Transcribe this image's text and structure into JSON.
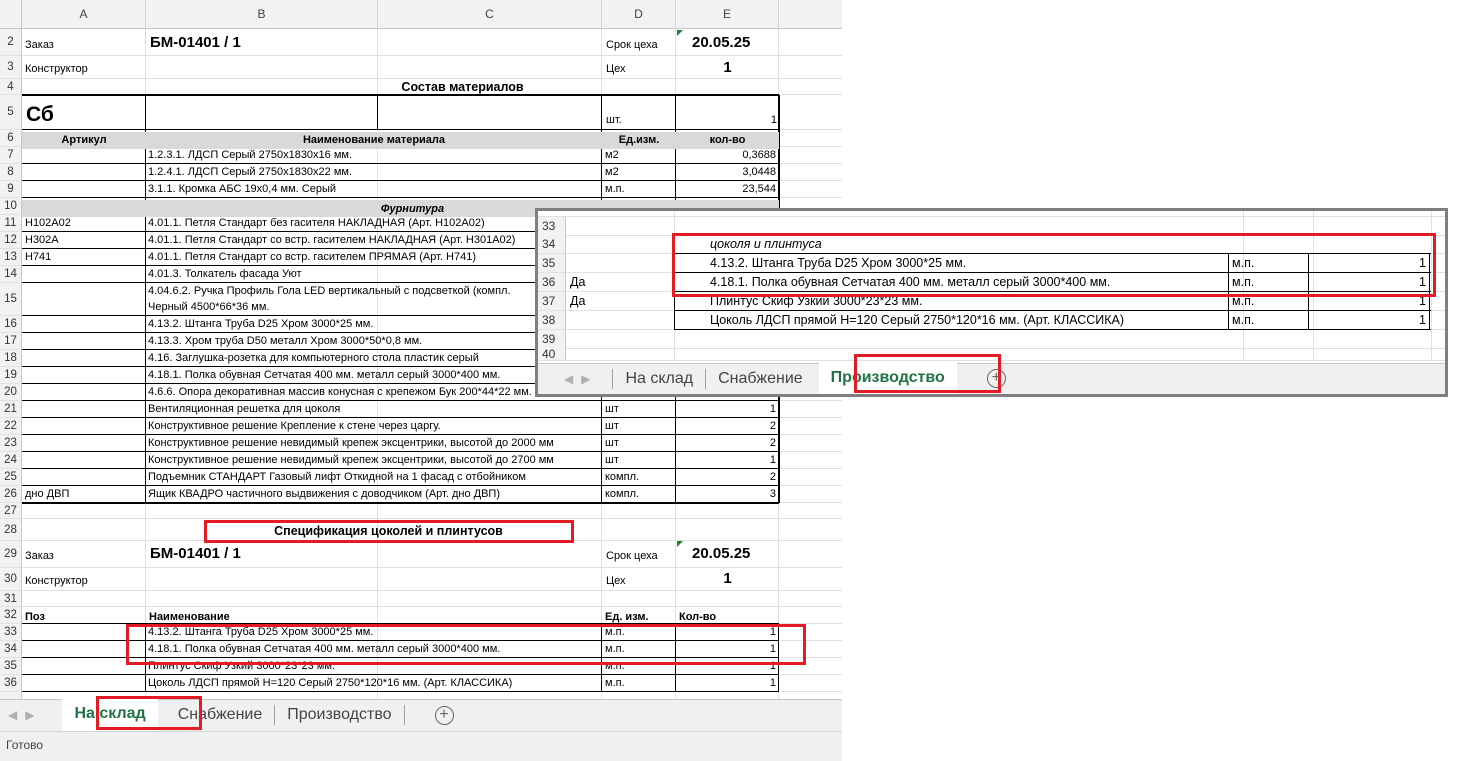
{
  "columns": [
    "A",
    "B",
    "C",
    "D",
    "E"
  ],
  "header": {
    "order_label": "Заказ",
    "order_value": "БМ-01401 / 1",
    "deadline_label": "Срок цеха",
    "deadline_value": "20.05.25",
    "designer_label": "Конструктор",
    "shop_label": "Цех",
    "shop_value": "1"
  },
  "materials": {
    "title": "Состав материалов",
    "group_code": "Сб",
    "group_unit": "шт.",
    "group_qty": "1",
    "col_article": "Артикул",
    "col_name": "Наименование материала",
    "col_unit": "Ед.изм.",
    "col_qty": "кол-во",
    "fittings_title": "Фурнитура",
    "rows": [
      {
        "num": "7",
        "article": "",
        "name": "1.2.3.1. ЛДСП Серый 2750х1830х16 мм.",
        "unit": "м2",
        "qty": "0,3688"
      },
      {
        "num": "8",
        "article": "",
        "name": "1.2.4.1. ЛДСП Серый 2750х1830х22 мм.",
        "unit": "м2",
        "qty": "3,0448"
      },
      {
        "num": "9",
        "article": "",
        "name": "3.1.1. Кромка АБС 19х0,4 мм. Серый",
        "unit": "м.п.",
        "qty": "23,544"
      },
      {
        "num": "11",
        "article": "H102A02",
        "name": "4.01.1. Петля Стандарт без гасителя НАКЛАДНАЯ (Арт.  H102A02)",
        "unit": "",
        "qty": ""
      },
      {
        "num": "12",
        "article": "H302A",
        "name": "4.01.1. Петля Стандарт со встр. гасителем НАКЛАДНАЯ (Арт. H301A02)",
        "unit": "",
        "qty": ""
      },
      {
        "num": "13",
        "article": "H741",
        "name": "4.01.1. Петля Стандарт со встр. гасителем ПРЯМАЯ (Арт.  H741)",
        "unit": "",
        "qty": ""
      },
      {
        "num": "14",
        "article": "",
        "name": "4.01.3. Толкатель фасада Уют",
        "unit": "",
        "qty": ""
      },
      {
        "num": "15",
        "article": "",
        "name": "4.04.6.2. Ручка Профиль  Гола LED вертикальный с подсветкой (компл.",
        "name2": "Черный 4500*66*36 мм.",
        "unit": "",
        "qty": ""
      },
      {
        "num": "16",
        "article": "",
        "name": "4.13.2.  Штанга Труба D25  Хром 3000*25 мм.",
        "unit": "",
        "qty": ""
      },
      {
        "num": "17",
        "article": "",
        "name": "4.13.3. Хром труба D50 металл Хром 3000*50*0,8 мм.",
        "unit": "",
        "qty": ""
      },
      {
        "num": "18",
        "article": "",
        "name": "4.16.  Заглушка-розетка для компьютерного стола пластик серый",
        "unit": "",
        "qty": ""
      },
      {
        "num": "19",
        "article": "",
        "name": "4.18.1.  Полка обувная Сетчатая  400 мм.  металл серый 3000*400 мм.",
        "unit": "",
        "qty": ""
      },
      {
        "num": "20",
        "article": "",
        "name": "4.6.6. Опора декоративная массив конусная с крепежом Бук 200*44*22 мм.",
        "unit": "",
        "qty": ""
      },
      {
        "num": "21",
        "article": "",
        "name": "Вентиляционная решетка для цоколя",
        "unit": "шт",
        "qty": "1"
      },
      {
        "num": "22",
        "article": "",
        "name": "Конструктивное решение Крепление к стене через царгу.",
        "unit": "шт",
        "qty": "2"
      },
      {
        "num": "23",
        "article": "",
        "name": "Конструктивное решение невидимый крепеж эксцентрики, высотой до 2000 мм",
        "unit": "шт",
        "qty": "2"
      },
      {
        "num": "24",
        "article": "",
        "name": "Конструктивное решение невидимый крепеж эксцентрики, высотой до 2700 мм",
        "unit": "шт",
        "qty": "1"
      },
      {
        "num": "25",
        "article": "",
        "name": "Подъемник СТАНДАРТ Газовый лифт  Откидной на 1 фасад с отбойником",
        "unit": "компл.",
        "qty": "2"
      },
      {
        "num": "26",
        "article": "дно ДВП",
        "name": "Ящик КВАДРО частичного  выдвижения с доводчиком (Арт. дно ДВП)",
        "unit": "компл.",
        "qty": "3"
      }
    ]
  },
  "spec": {
    "title": "Спецификация цоколей и плинтусов",
    "col_pos": "Поз",
    "col_name": "Наименование",
    "col_unit": "Ед. изм.",
    "col_qty": "Кол-во",
    "rows": [
      {
        "num": "33",
        "name": "4.13.2.  Штанга Труба D25  Хром 3000*25 мм.",
        "unit": "м.п.",
        "qty": "1"
      },
      {
        "num": "34",
        "name": "4.18.1.  Полка обувная Сетчатая  400 мм.  металл серый 3000*400 мм.",
        "unit": "м.п.",
        "qty": "1"
      },
      {
        "num": "35",
        "name": "Плинтус Скиф Узкий 3000*23*23 мм.",
        "unit": "м.п.",
        "qty": "1"
      },
      {
        "num": "36",
        "name": "Цоколь ЛДСП прямой H=120 Серый 2750*120*16 мм. (Арт. КЛАССИКА)",
        "unit": "м.п.",
        "qty": "1"
      }
    ]
  },
  "sheet_tabs": [
    "На склад",
    "Снабжение",
    "Производство"
  ],
  "status_bar": "Готово",
  "inset": {
    "section_label": "цоколя и плинтуса",
    "rows": [
      {
        "num": "35",
        "flag": "",
        "name": "4.13.2.  Штанга Труба D25  Хром 3000*25 мм.",
        "unit": "м.п.",
        "qty": "1"
      },
      {
        "num": "36",
        "flag": "Да",
        "name": "4.18.1.  Полка обувная Сетчатая  400 мм.  металл серый 3000*400 мм.",
        "unit": "м.п.",
        "qty": "1"
      },
      {
        "num": "37",
        "flag": "Да",
        "name": "Плинтус Скиф Узкий 3000*23*23 мм.",
        "unit": "м.п.",
        "qty": "1"
      },
      {
        "num": "38",
        "flag": "",
        "name": "Цоколь ЛДСП прямой H=120 Серый 2750*120*16 мм. (Арт. КЛАССИКА)",
        "unit": "м.п.",
        "qty": "1"
      }
    ]
  }
}
